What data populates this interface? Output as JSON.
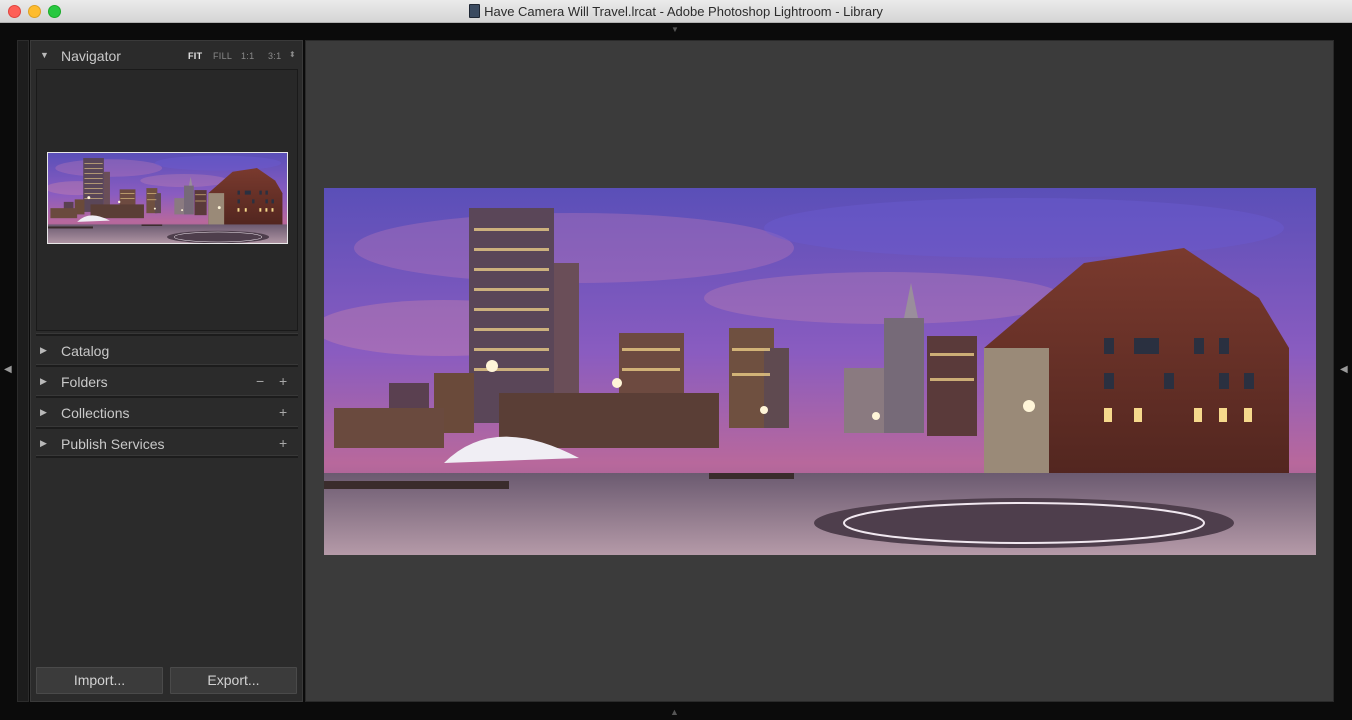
{
  "window": {
    "title": "Have Camera Will Travel.lrcat - Adobe Photoshop Lightroom - Library"
  },
  "navigator": {
    "label": "Navigator",
    "zoom_options": [
      "FIT",
      "FILL",
      "1:1",
      "3:1"
    ],
    "active_zoom": "FIT"
  },
  "panels": [
    {
      "label": "Catalog",
      "buttons": []
    },
    {
      "label": "Folders",
      "buttons": [
        "−",
        "+"
      ]
    },
    {
      "label": "Collections",
      "buttons": [
        "+"
      ]
    },
    {
      "label": "Publish Services",
      "buttons": [
        "+"
      ]
    }
  ],
  "buttons": {
    "import": "Import...",
    "export": "Export..."
  },
  "icons": {
    "expanded": "triangle-down-icon",
    "collapsed": "triangle-right-icon"
  },
  "colors": {
    "panel_bg": "#2b2b2b",
    "main_bg": "#3b3b3b",
    "text": "#c9c9c9"
  }
}
